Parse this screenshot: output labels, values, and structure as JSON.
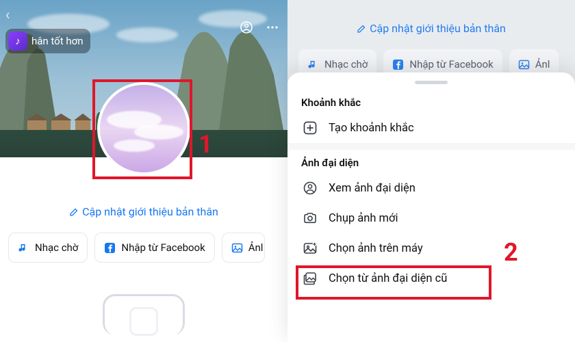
{
  "left": {
    "app_chip_text": "hân tốt hơn",
    "bio_link": "Cập nhật giới thiệu bản thân",
    "chips": {
      "music": "Nhạc chờ",
      "fb": "Nhập từ Facebook",
      "image_partial": "Ảnl"
    },
    "step_marker": "1"
  },
  "right": {
    "bg_bio_link": "Cập nhật giới thiệu bản thân",
    "bg_chips": {
      "music": "Nhạc chờ",
      "fb": "Nhập từ Facebook",
      "image_partial": "Ảnl"
    },
    "sheet": {
      "section_moment": "Khoảnh khắc",
      "item_create_moment": "Tạo khoảnh khắc",
      "section_avatar": "Ảnh đại diện",
      "item_view_avatar": "Xem ảnh đại diện",
      "item_take_photo": "Chụp ảnh mới",
      "item_choose_device": "Chọn ảnh trên máy",
      "item_choose_old": "Chọn từ ảnh đại diện cũ"
    },
    "step_marker": "2"
  }
}
